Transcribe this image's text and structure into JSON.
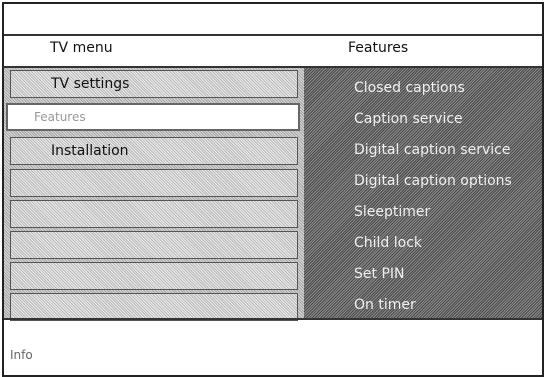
{
  "header": {
    "menu_title": "TV menu",
    "panel_title": "Features"
  },
  "left_menu": {
    "items": [
      {
        "label": "TV settings",
        "selected": false
      },
      {
        "label": "Features",
        "selected": true
      },
      {
        "label": "Installation",
        "selected": false
      },
      {
        "label": "",
        "selected": false
      },
      {
        "label": "",
        "selected": false
      },
      {
        "label": "",
        "selected": false
      },
      {
        "label": "",
        "selected": false
      },
      {
        "label": "",
        "selected": false
      }
    ]
  },
  "right_menu": {
    "items": [
      "Closed captions",
      "Caption service",
      "Digital caption service",
      "Digital caption options",
      "Sleeptimer",
      "Child lock",
      "Set PIN",
      "On timer"
    ]
  },
  "footer": {
    "info": "Info"
  }
}
